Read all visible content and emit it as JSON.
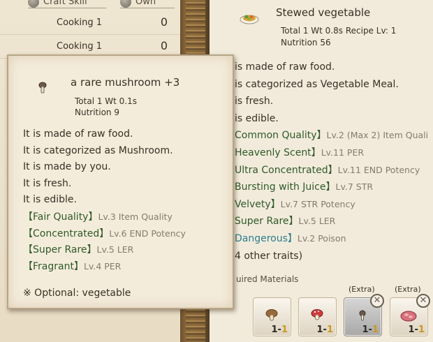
{
  "list_panel": {
    "columns": {
      "skill": "Craft Skill",
      "own": "Own"
    },
    "rows": [
      {
        "skill": "Cooking 1",
        "own": "0"
      },
      {
        "skill": "Cooking 1",
        "own": "0"
      }
    ]
  },
  "recipe": {
    "title": "Stewed vegetable",
    "stats_line1": "Total 1  Wt 0.8s   Recipe Lv: 1",
    "stats_line2": "Nutrition 56",
    "description": [
      "is made of raw food.",
      "is categorized as Vegetable Meal.",
      "is fresh.",
      "is edible."
    ],
    "traits": [
      {
        "name": "Common Quality】",
        "detail": "Lv.2 (Max 2) Item Quali"
      },
      {
        "name": "Heavenly Scent】",
        "detail": "Lv.11 PER"
      },
      {
        "name": "Ultra Concentrated】",
        "detail": "Lv.11 END Potency"
      },
      {
        "name": "Bursting with Juice】",
        "detail": "Lv.7 STR"
      },
      {
        "name": "Velvety】",
        "detail": "Lv.7 STR Potency"
      },
      {
        "name": "Super Rare】",
        "detail": "Lv.5 LER"
      },
      {
        "name": "Dangerous】",
        "detail": "Lv.2 Poison"
      }
    ],
    "more_traits": "4 other traits)",
    "required_label": "uired Materials",
    "materials": [
      {
        "icon": "mushroom-icon",
        "qty_prefix": "1-",
        "qty_hl": "1",
        "extra": ""
      },
      {
        "icon": "red-mushroom-icon",
        "qty_prefix": "1-",
        "qty_hl": "1",
        "extra": ""
      },
      {
        "icon": "small-mushroom-icon",
        "qty_prefix": "1-",
        "qty_hl": "1",
        "extra": "(Extra)"
      },
      {
        "icon": "meat-icon",
        "qty_prefix": "1-",
        "qty_hl": "1",
        "extra": "(Extra)"
      }
    ],
    "remove_glyph": "✕"
  },
  "tooltip": {
    "title": "a rare mushroom +3",
    "stats_line1": "Total 1  Wt 0.1s",
    "stats_line2": "Nutrition 9",
    "description": [
      "It is made of raw food.",
      "It is categorized as Mushroom.",
      "It is made by you.",
      "It is fresh.",
      "It is edible."
    ],
    "traits": [
      {
        "name": "【Fair Quality】",
        "detail": "Lv.3 Item Quality"
      },
      {
        "name": "【Concentrated】",
        "detail": "Lv.6 END Potency"
      },
      {
        "name": "【Super Rare】",
        "detail": "Lv.5 LER"
      },
      {
        "name": "【Fragrant】",
        "detail": "Lv.4 PER"
      }
    ],
    "optional": "※ Optional: vegetable"
  },
  "colors": {
    "trait_green": "#2f5a28",
    "trait_teal": "#2c7e8a",
    "qty_highlight": "#c99a1a"
  }
}
